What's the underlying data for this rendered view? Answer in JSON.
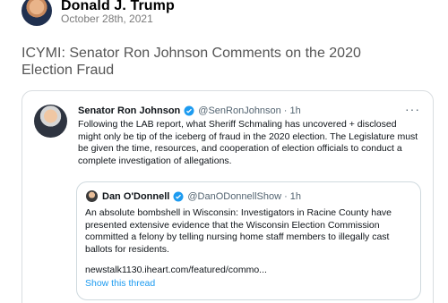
{
  "post": {
    "author_name": "Donald J. Trump",
    "date": "October 28th, 2021",
    "text": "ICYMI: Senator Ron Johnson Comments on the 2020 Election Fraud"
  },
  "embedded_tweet": {
    "name": "Senator Ron Johnson",
    "handle": "@SenRonJohnson",
    "separator": "·",
    "time": "1h",
    "more_label": "···",
    "text": "Following the LAB report, what Sheriff Schmaling has uncovered + disclosed might only be tip of the iceberg of fraud in the 2020 election. The Legislature must be given the time, resources, and cooperation of election officials to conduct a complete investigation of allegations.",
    "verified_color": "#1d9bf0",
    "quote": {
      "name": "Dan O'Donnell",
      "handle": "@DanODonnellShow",
      "separator": "·",
      "time": "1h",
      "text": "An absolute bombshell in Wisconsin: Investigators in Racine County have presented extensive evidence that the Wisconsin Election Commission committed a felony by telling nursing home staff members to illegally cast ballots for residents.",
      "link": "newstalk1130.iheart.com/featured/commo...",
      "show_thread": "Show this thread"
    }
  }
}
